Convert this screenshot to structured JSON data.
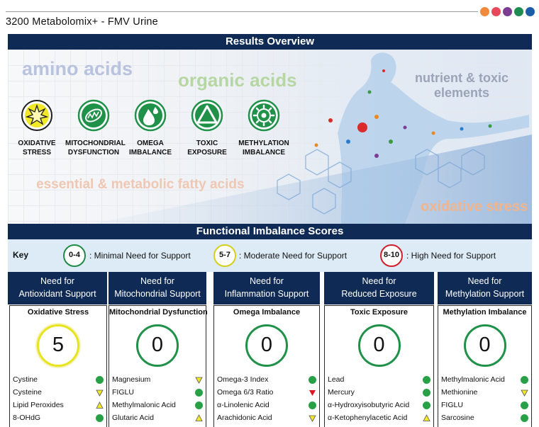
{
  "document": {
    "title": "3200 Metabolomix+ - FMV Urine"
  },
  "brand_dots": [
    "#f08a3c",
    "#e8485c",
    "#7b3c94",
    "#1f8c52",
    "#1d5ea8"
  ],
  "overview": {
    "heading": "Results Overview",
    "watermarks": {
      "amino": "amino acids",
      "organic": "organic acids",
      "nutrient": "nutrient & toxic elements",
      "fatty": "essential & metabolic fatty acids",
      "oxidative": "oxidative stress"
    },
    "categories": [
      {
        "line1": "OXIDATIVE",
        "line2": "STRESS",
        "icon": "sun-icon",
        "color": "#f1e928"
      },
      {
        "line1": "MITOCHONDRIAL",
        "line2": "DYSFUNCTION",
        "icon": "mitochondria-icon",
        "color": "#1f9149"
      },
      {
        "line1": "OMEGA",
        "line2": "IMBALANCE",
        "icon": "droplets-icon",
        "color": "#1f9149"
      },
      {
        "line1": "TOXIC",
        "line2": "EXPOSURE",
        "icon": "triangle-icon",
        "color": "#1f9149"
      },
      {
        "line1": "METHYLATION",
        "line2": "IMBALANCE",
        "icon": "gear-icon",
        "color": "#1f9149"
      }
    ]
  },
  "functional": {
    "heading": "Functional Imbalance Scores",
    "key": {
      "label": "Key",
      "items": [
        {
          "badge": "0-4",
          "text": ": Minimal Need for Support",
          "level": "green"
        },
        {
          "badge": "5-7",
          "text": ": Moderate Need for Support",
          "level": "yellow"
        },
        {
          "badge": "8-10",
          "text": ": High Need for Support",
          "level": "red"
        }
      ]
    },
    "columns": [
      {
        "head1": "Need for",
        "head2": "Antioxidant Support",
        "sub": "Oxidative Stress",
        "score": "5",
        "level": "yellow",
        "rows": [
          {
            "name": "Cystine",
            "marker": "green-dot"
          },
          {
            "name": "Cysteine",
            "marker": "yellow-down-triangle"
          },
          {
            "name": "Lipid Peroxides",
            "marker": "yellow-up-triangle"
          },
          {
            "name": "8-OHdG",
            "marker": "green-dot"
          }
        ]
      },
      {
        "head1": "Need for",
        "head2": "Mitochondrial Support",
        "sub": "Mitochondrial Dysfunction",
        "score": "0",
        "level": "green",
        "rows": [
          {
            "name": "Magnesium",
            "marker": "yellow-down-triangle"
          },
          {
            "name": "FIGLU",
            "marker": "green-dot"
          },
          {
            "name": "Methylmalonic Acid",
            "marker": "green-dot"
          },
          {
            "name": "Glutaric Acid",
            "marker": "yellow-up-triangle"
          }
        ]
      },
      {
        "head1": "Need for",
        "head2": "Inflammation Support",
        "sub": "Omega Imbalance",
        "score": "0",
        "level": "green",
        "rows": [
          {
            "name": "Omega-3 Index",
            "marker": "green-dot"
          },
          {
            "name": "Omega 6/3 Ratio",
            "marker": "red-down-triangle"
          },
          {
            "name": "α-Linolenic Acid",
            "marker": "green-dot"
          },
          {
            "name": "Arachidonic Acid",
            "marker": "yellow-down-triangle"
          }
        ]
      },
      {
        "head1": "Need for",
        "head2": "Reduced Exposure",
        "sub": "Toxic Exposure",
        "score": "0",
        "level": "green",
        "rows": [
          {
            "name": "Lead",
            "marker": "green-dot"
          },
          {
            "name": "Mercury",
            "marker": "green-dot"
          },
          {
            "name": "α-Hydroxyisobutyric Acid",
            "marker": "green-dot"
          },
          {
            "name": "α-Ketophenylacetic Acid",
            "marker": "yellow-up-triangle"
          }
        ]
      },
      {
        "head1": "Need for",
        "head2": "Methylation Support",
        "sub": "Methylation Imbalance",
        "score": "0",
        "level": "green",
        "rows": [
          {
            "name": "Methylmalonic Acid",
            "marker": "green-dot"
          },
          {
            "name": "Methionine",
            "marker": "yellow-down-triangle"
          },
          {
            "name": "FIGLU",
            "marker": "green-dot"
          },
          {
            "name": "Sarcosine",
            "marker": "green-dot"
          }
        ]
      }
    ]
  }
}
